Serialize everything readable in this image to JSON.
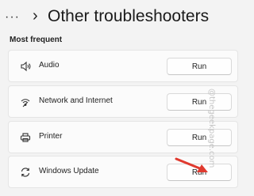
{
  "header": {
    "more_glyph": "···",
    "chevron_glyph": "›",
    "title": "Other troubleshooters"
  },
  "section": {
    "label": "Most frequent"
  },
  "items": [
    {
      "label": "Audio",
      "icon": "speaker-icon",
      "button": "Run"
    },
    {
      "label": "Network and Internet",
      "icon": "wifi-icon",
      "button": "Run"
    },
    {
      "label": "Printer",
      "icon": "printer-icon",
      "button": "Run"
    },
    {
      "label": "Windows Update",
      "icon": "refresh-icon",
      "button": "Run"
    }
  ],
  "watermark": "@thegeekpage.com",
  "colors": {
    "arrow": "#e03a2f",
    "background": "#f3f3f3",
    "card": "#fbfbfb"
  }
}
